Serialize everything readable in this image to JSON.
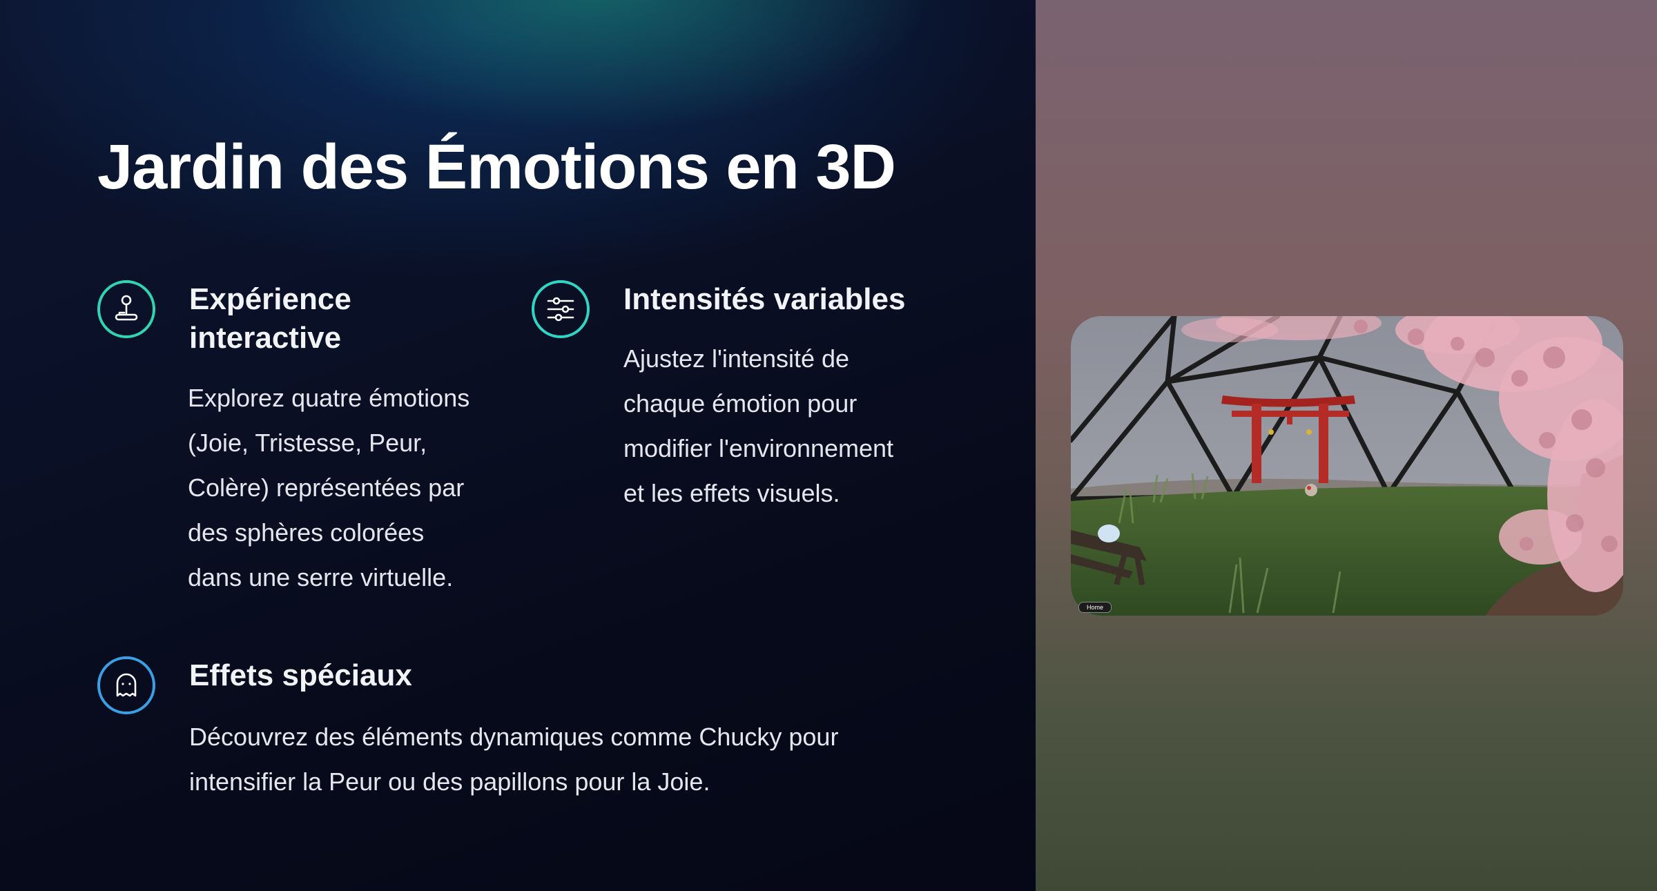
{
  "title": "Jardin des Émotions en 3D",
  "features": [
    {
      "icon": "joystick-icon",
      "icon_color": "#2fd6b4",
      "title_line1": "Expérience",
      "title_line2": "interactive",
      "lines": [
        "Explorez quatre émotions",
        "(Joie, Tristesse, Peur,",
        "Colère) représentées par",
        "des sphères colorées",
        "dans une serre virtuelle."
      ]
    },
    {
      "icon": "sliders-icon",
      "icon_color": "#2fd6c4",
      "title": "Intensités variables",
      "lines": [
        "Ajustez l'intensité de",
        "chaque émotion pour",
        "modifier l'environnement",
        "et les effets visuels."
      ]
    },
    {
      "icon": "ghost-icon",
      "icon_color": "#3aa0e6",
      "title": "Effets spéciaux",
      "lines": [
        "Découvrez des éléments dynamiques comme Chucky pour",
        "intensifier la Peur ou des papillons pour la Joie."
      ]
    }
  ],
  "preview": {
    "home_label": "Home"
  }
}
